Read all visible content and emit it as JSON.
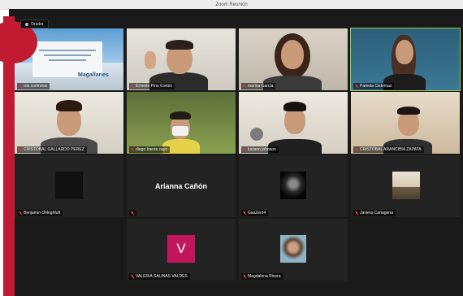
{
  "window": {
    "title": "Zoom Reunión"
  },
  "speaker_view": {
    "label": "Orador"
  },
  "participants": [
    {
      "name": "isis contreras"
    },
    {
      "name": "Ernesto Pino Cortés"
    },
    {
      "name": "marina Garcia"
    },
    {
      "name": "Pamela Cisternas"
    },
    {
      "name": "CRISTOBAL GALLARDO PEREZ"
    },
    {
      "name": "diego baeza cayo"
    },
    {
      "name": "luciano johnson"
    },
    {
      "name": "CRISTOBAL ARANCIBIA ZAPATA"
    },
    {
      "name": "Benjamin Ohlrighfuft"
    },
    {
      "name": "Arianna Cañon",
      "display": "Arianna Cañón"
    },
    {
      "name": "GasZero4"
    },
    {
      "name": "Javiera Cartagena"
    },
    {
      "name": "VALERIA SALINAS VALDES",
      "initial": "V"
    },
    {
      "name": "Magdalena Rivera"
    }
  ],
  "banner": {
    "logo_text": "Magallanes"
  },
  "colors": {
    "accent_red": "#c11b32",
    "active_border": "#9ccc3c",
    "avatar_pink": "#c2185b"
  }
}
